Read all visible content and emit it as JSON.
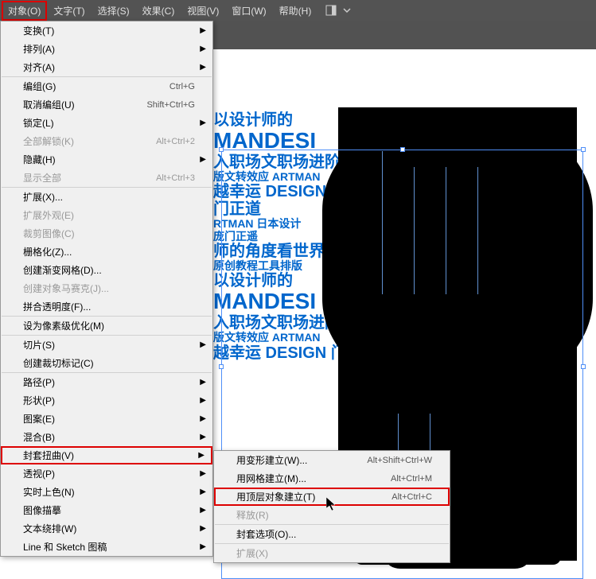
{
  "menubar": {
    "items": [
      {
        "label": "对象(O)"
      },
      {
        "label": "文字(T)"
      },
      {
        "label": "选择(S)"
      },
      {
        "label": "效果(C)"
      },
      {
        "label": "视图(V)"
      },
      {
        "label": "窗口(W)"
      },
      {
        "label": "帮助(H)"
      }
    ]
  },
  "dropdown": {
    "groups": [
      [
        {
          "label": "变换(T)",
          "arrow": true
        },
        {
          "label": "排列(A)",
          "arrow": true
        },
        {
          "label": "对齐(A)",
          "arrow": true
        }
      ],
      [
        {
          "label": "编组(G)",
          "shortcut": "Ctrl+G"
        },
        {
          "label": "取消编组(U)",
          "shortcut": "Shift+Ctrl+G"
        },
        {
          "label": "锁定(L)",
          "arrow": true
        },
        {
          "label": "全部解锁(K)",
          "shortcut": "Alt+Ctrl+2",
          "disabled": true
        },
        {
          "label": "隐藏(H)",
          "arrow": true
        },
        {
          "label": "显示全部",
          "shortcut": "Alt+Ctrl+3",
          "disabled": true
        }
      ],
      [
        {
          "label": "扩展(X)..."
        },
        {
          "label": "扩展外观(E)",
          "disabled": true
        },
        {
          "label": "裁剪图像(C)",
          "disabled": true
        },
        {
          "label": "栅格化(Z)..."
        },
        {
          "label": "创建渐变网格(D)..."
        },
        {
          "label": "创建对象马赛克(J)...",
          "disabled": true
        },
        {
          "label": "拼合透明度(F)..."
        }
      ],
      [
        {
          "label": "设为像素级优化(M)"
        }
      ],
      [
        {
          "label": "切片(S)",
          "arrow": true
        },
        {
          "label": "创建裁切标记(C)"
        }
      ],
      [
        {
          "label": "路径(P)",
          "arrow": true
        },
        {
          "label": "形状(P)",
          "arrow": true
        },
        {
          "label": "图案(E)",
          "arrow": true
        },
        {
          "label": "混合(B)",
          "arrow": true
        },
        {
          "label": "封套扭曲(V)",
          "arrow": true,
          "highlighted": true
        },
        {
          "label": "透视(P)",
          "arrow": true
        },
        {
          "label": "实时上色(N)",
          "arrow": true
        },
        {
          "label": "图像描摹",
          "arrow": true
        },
        {
          "label": "文本绕排(W)",
          "arrow": true
        },
        {
          "label": "Line 和 Sketch 图稿",
          "arrow": true
        }
      ]
    ]
  },
  "submenu": {
    "groups": [
      [
        {
          "label": "用变形建立(W)...",
          "shortcut": "Alt+Shift+Ctrl+W"
        },
        {
          "label": "用网格建立(M)...",
          "shortcut": "Alt+Ctrl+M"
        },
        {
          "label": "用顶层对象建立(T)",
          "shortcut": "Alt+Ctrl+C",
          "highlighted": true
        },
        {
          "label": "释放(R)",
          "disabled": true
        }
      ],
      [
        {
          "label": "封套选项(O)..."
        }
      ],
      [
        {
          "label": "扩展(X)",
          "disabled": true
        }
      ]
    ]
  },
  "canvas_text": {
    "lines": [
      {
        "text": "以设计师的",
        "cls": "tl-med"
      },
      {
        "text": "MANDESI",
        "cls": "tl-big"
      },
      {
        "text": "入职场文职场进阶",
        "cls": "tl-med"
      },
      {
        "text": "版文转效应 ARTMAN",
        "cls": "tl-sm"
      },
      {
        "text": "越幸运 DESIGN",
        "cls": "tl-med"
      },
      {
        "text": "门正道",
        "cls": "tl-med"
      },
      {
        "text": "RTMAN 日本设计",
        "cls": "tl-sm"
      },
      {
        "text": "庞门正遥",
        "cls": "tl-sm"
      },
      {
        "text": "师的角度看世界",
        "cls": "tl-med"
      },
      {
        "text": "原创教程工具排版",
        "cls": "tl-sm"
      },
      {
        "text": "以设计师的",
        "cls": "tl-med"
      },
      {
        "text": "MANDESI",
        "cls": "tl-big"
      },
      {
        "text": "入职场文职场进阶 庞",
        "cls": "tl-med"
      },
      {
        "text": "版文转效应 ARTMAN",
        "cls": "tl-sm"
      },
      {
        "text": "越幸运 DESIGN 门",
        "cls": "tl-med"
      }
    ]
  }
}
